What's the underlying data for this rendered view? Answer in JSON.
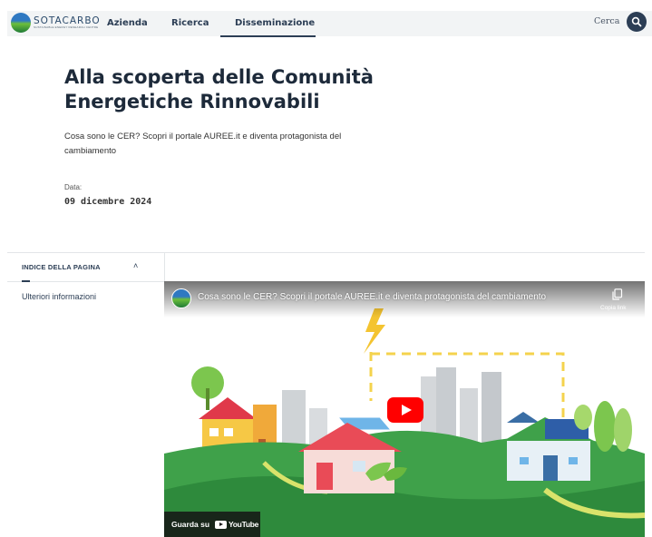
{
  "header": {
    "logo": {
      "name": "SOTACARBO",
      "subtitle": "SUSTAINABLE ENERGY RESEARCH CENTRE"
    },
    "nav": [
      {
        "label": "Azienda",
        "active": false
      },
      {
        "label": "Ricerca",
        "active": false
      },
      {
        "label": "Disseminazione",
        "active": true
      }
    ],
    "search_label": "Cerca",
    "search_icon": "search-icon"
  },
  "article": {
    "title": "Alla scoperta delle Comunità Energetiche Rinnovabili",
    "subtitle": "Cosa sono le CER? Scopri il portale AUREE.it e diventa protagonista del cambiamento",
    "date_label": "Data:",
    "date_value": "09 dicembre 2024"
  },
  "toc": {
    "header": "INDICE DELLA PAGINA",
    "caret_icon": "chevron-up-icon",
    "items": [
      "Ulteriori informazioni"
    ]
  },
  "video": {
    "title": "Cosa sono le CER? Scopri il portale AUREE.it e diventa protagonista del cambiamento",
    "copy_label": "Copia link",
    "watch_on": "Guarda su",
    "youtube": "YouTube",
    "play_icon": "play-icon"
  },
  "colors": {
    "header_bg": "#f2f4f5",
    "brand_navy": "#2c3e55",
    "youtube_red": "#ff0000"
  }
}
